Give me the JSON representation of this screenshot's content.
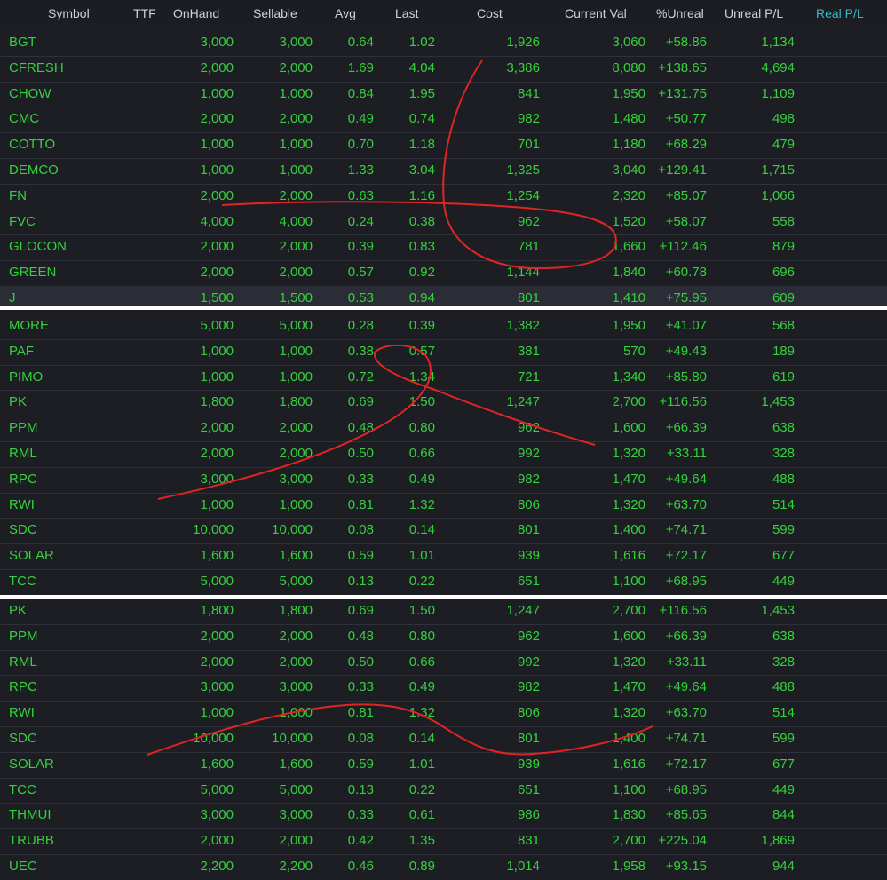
{
  "columns": [
    "Symbol",
    "TTF",
    "OnHand",
    "Sellable",
    "Avg",
    "Last",
    "Cost",
    "Current Val",
    "%Unreal",
    "Unreal P/L",
    "Real P/L"
  ],
  "colors": {
    "panel_bg": "#1c1e24",
    "text_green": "#35d13c",
    "header_text": "#cfd2d8",
    "active_header": "#3ab6c9",
    "annotation_red": "#e02424"
  },
  "panels": [
    {
      "rows": [
        {
          "symbol": "BGT",
          "onhand": "3,000",
          "sellable": "3,000",
          "avg": "0.64",
          "last": "1.02",
          "cost": "1,926",
          "current_val": "3,060",
          "pct_unreal": "+58.86",
          "unreal_pl": "1,134"
        },
        {
          "symbol": "CFRESH",
          "onhand": "2,000",
          "sellable": "2,000",
          "avg": "1.69",
          "last": "4.04",
          "cost": "3,386",
          "current_val": "8,080",
          "pct_unreal": "+138.65",
          "unreal_pl": "4,694"
        },
        {
          "symbol": "CHOW",
          "onhand": "1,000",
          "sellable": "1,000",
          "avg": "0.84",
          "last": "1.95",
          "cost": "841",
          "current_val": "1,950",
          "pct_unreal": "+131.75",
          "unreal_pl": "1,109"
        },
        {
          "symbol": "CMC",
          "onhand": "2,000",
          "sellable": "2,000",
          "avg": "0.49",
          "last": "0.74",
          "cost": "982",
          "current_val": "1,480",
          "pct_unreal": "+50.77",
          "unreal_pl": "498"
        },
        {
          "symbol": "COTTO",
          "onhand": "1,000",
          "sellable": "1,000",
          "avg": "0.70",
          "last": "1.18",
          "cost": "701",
          "current_val": "1,180",
          "pct_unreal": "+68.29",
          "unreal_pl": "479"
        },
        {
          "symbol": "DEMCO",
          "onhand": "1,000",
          "sellable": "1,000",
          "avg": "1.33",
          "last": "3.04",
          "cost": "1,325",
          "current_val": "3,040",
          "pct_unreal": "+129.41",
          "unreal_pl": "1,715"
        },
        {
          "symbol": "FN",
          "onhand": "2,000",
          "sellable": "2,000",
          "avg": "0.63",
          "last": "1.16",
          "cost": "1,254",
          "current_val": "2,320",
          "pct_unreal": "+85.07",
          "unreal_pl": "1,066"
        },
        {
          "symbol": "FVC",
          "onhand": "4,000",
          "sellable": "4,000",
          "avg": "0.24",
          "last": "0.38",
          "cost": "962",
          "current_val": "1,520",
          "pct_unreal": "+58.07",
          "unreal_pl": "558"
        },
        {
          "symbol": "GLOCON",
          "onhand": "2,000",
          "sellable": "2,000",
          "avg": "0.39",
          "last": "0.83",
          "cost": "781",
          "current_val": "1,660",
          "pct_unreal": "+112.46",
          "unreal_pl": "879"
        },
        {
          "symbol": "GREEN",
          "onhand": "2,000",
          "sellable": "2,000",
          "avg": "0.57",
          "last": "0.92",
          "cost": "1,144",
          "current_val": "1,840",
          "pct_unreal": "+60.78",
          "unreal_pl": "696"
        },
        {
          "symbol": "J",
          "onhand": "1,500",
          "sellable": "1,500",
          "avg": "0.53",
          "last": "0.94",
          "cost": "801",
          "current_val": "1,410",
          "pct_unreal": "+75.95",
          "unreal_pl": "609",
          "selected": true
        }
      ]
    },
    {
      "rows": [
        {
          "symbol": "MORE",
          "onhand": "5,000",
          "sellable": "5,000",
          "avg": "0.28",
          "last": "0.39",
          "cost": "1,382",
          "current_val": "1,950",
          "pct_unreal": "+41.07",
          "unreal_pl": "568"
        },
        {
          "symbol": "PAF",
          "onhand": "1,000",
          "sellable": "1,000",
          "avg": "0.38",
          "last": "0.57",
          "cost": "381",
          "current_val": "570",
          "pct_unreal": "+49.43",
          "unreal_pl": "189"
        },
        {
          "symbol": "PIMO",
          "onhand": "1,000",
          "sellable": "1,000",
          "avg": "0.72",
          "last": "1.34",
          "cost": "721",
          "current_val": "1,340",
          "pct_unreal": "+85.80",
          "unreal_pl": "619"
        },
        {
          "symbol": "PK",
          "onhand": "1,800",
          "sellable": "1,800",
          "avg": "0.69",
          "last": "1.50",
          "cost": "1,247",
          "current_val": "2,700",
          "pct_unreal": "+116.56",
          "unreal_pl": "1,453"
        },
        {
          "symbol": "PPM",
          "onhand": "2,000",
          "sellable": "2,000",
          "avg": "0.48",
          "last": "0.80",
          "cost": "962",
          "current_val": "1,600",
          "pct_unreal": "+66.39",
          "unreal_pl": "638"
        },
        {
          "symbol": "RML",
          "onhand": "2,000",
          "sellable": "2,000",
          "avg": "0.50",
          "last": "0.66",
          "cost": "992",
          "current_val": "1,320",
          "pct_unreal": "+33.11",
          "unreal_pl": "328"
        },
        {
          "symbol": "RPC",
          "onhand": "3,000",
          "sellable": "3,000",
          "avg": "0.33",
          "last": "0.49",
          "cost": "982",
          "current_val": "1,470",
          "pct_unreal": "+49.64",
          "unreal_pl": "488"
        },
        {
          "symbol": "RWI",
          "onhand": "1,000",
          "sellable": "1,000",
          "avg": "0.81",
          "last": "1.32",
          "cost": "806",
          "current_val": "1,320",
          "pct_unreal": "+63.70",
          "unreal_pl": "514"
        },
        {
          "symbol": "SDC",
          "onhand": "10,000",
          "sellable": "10,000",
          "avg": "0.08",
          "last": "0.14",
          "cost": "801",
          "current_val": "1,400",
          "pct_unreal": "+74.71",
          "unreal_pl": "599"
        },
        {
          "symbol": "SOLAR",
          "onhand": "1,600",
          "sellable": "1,600",
          "avg": "0.59",
          "last": "1.01",
          "cost": "939",
          "current_val": "1,616",
          "pct_unreal": "+72.17",
          "unreal_pl": "677"
        },
        {
          "symbol": "TCC",
          "onhand": "5,000",
          "sellable": "5,000",
          "avg": "0.13",
          "last": "0.22",
          "cost": "651",
          "current_val": "1,100",
          "pct_unreal": "+68.95",
          "unreal_pl": "449"
        }
      ]
    },
    {
      "rows": [
        {
          "symbol": "PK",
          "onhand": "1,800",
          "sellable": "1,800",
          "avg": "0.69",
          "last": "1.50",
          "cost": "1,247",
          "current_val": "2,700",
          "pct_unreal": "+116.56",
          "unreal_pl": "1,453"
        },
        {
          "symbol": "PPM",
          "onhand": "2,000",
          "sellable": "2,000",
          "avg": "0.48",
          "last": "0.80",
          "cost": "962",
          "current_val": "1,600",
          "pct_unreal": "+66.39",
          "unreal_pl": "638"
        },
        {
          "symbol": "RML",
          "onhand": "2,000",
          "sellable": "2,000",
          "avg": "0.50",
          "last": "0.66",
          "cost": "992",
          "current_val": "1,320",
          "pct_unreal": "+33.11",
          "unreal_pl": "328"
        },
        {
          "symbol": "RPC",
          "onhand": "3,000",
          "sellable": "3,000",
          "avg": "0.33",
          "last": "0.49",
          "cost": "982",
          "current_val": "1,470",
          "pct_unreal": "+49.64",
          "unreal_pl": "488"
        },
        {
          "symbol": "RWI",
          "onhand": "1,000",
          "sellable": "1,000",
          "avg": "0.81",
          "last": "1.32",
          "cost": "806",
          "current_val": "1,320",
          "pct_unreal": "+63.70",
          "unreal_pl": "514"
        },
        {
          "symbol": "SDC",
          "onhand": "10,000",
          "sellable": "10,000",
          "avg": "0.08",
          "last": "0.14",
          "cost": "801",
          "current_val": "1,400",
          "pct_unreal": "+74.71",
          "unreal_pl": "599"
        },
        {
          "symbol": "SOLAR",
          "onhand": "1,600",
          "sellable": "1,600",
          "avg": "0.59",
          "last": "1.01",
          "cost": "939",
          "current_val": "1,616",
          "pct_unreal": "+72.17",
          "unreal_pl": "677"
        },
        {
          "symbol": "TCC",
          "onhand": "5,000",
          "sellable": "5,000",
          "avg": "0.13",
          "last": "0.22",
          "cost": "651",
          "current_val": "1,100",
          "pct_unreal": "+68.95",
          "unreal_pl": "449"
        },
        {
          "symbol": "THMUI",
          "onhand": "3,000",
          "sellable": "3,000",
          "avg": "0.33",
          "last": "0.61",
          "cost": "986",
          "current_val": "1,830",
          "pct_unreal": "+85.65",
          "unreal_pl": "844"
        },
        {
          "symbol": "TRUBB",
          "onhand": "2,000",
          "sellable": "2,000",
          "avg": "0.42",
          "last": "1.35",
          "cost": "831",
          "current_val": "2,700",
          "pct_unreal": "+225.04",
          "unreal_pl": "1,869"
        },
        {
          "symbol": "UEC",
          "onhand": "2,200",
          "sellable": "2,200",
          "avg": "0.46",
          "last": "0.89",
          "cost": "1,014",
          "current_val": "1,958",
          "pct_unreal": "+93.15",
          "unreal_pl": "944"
        }
      ]
    }
  ]
}
